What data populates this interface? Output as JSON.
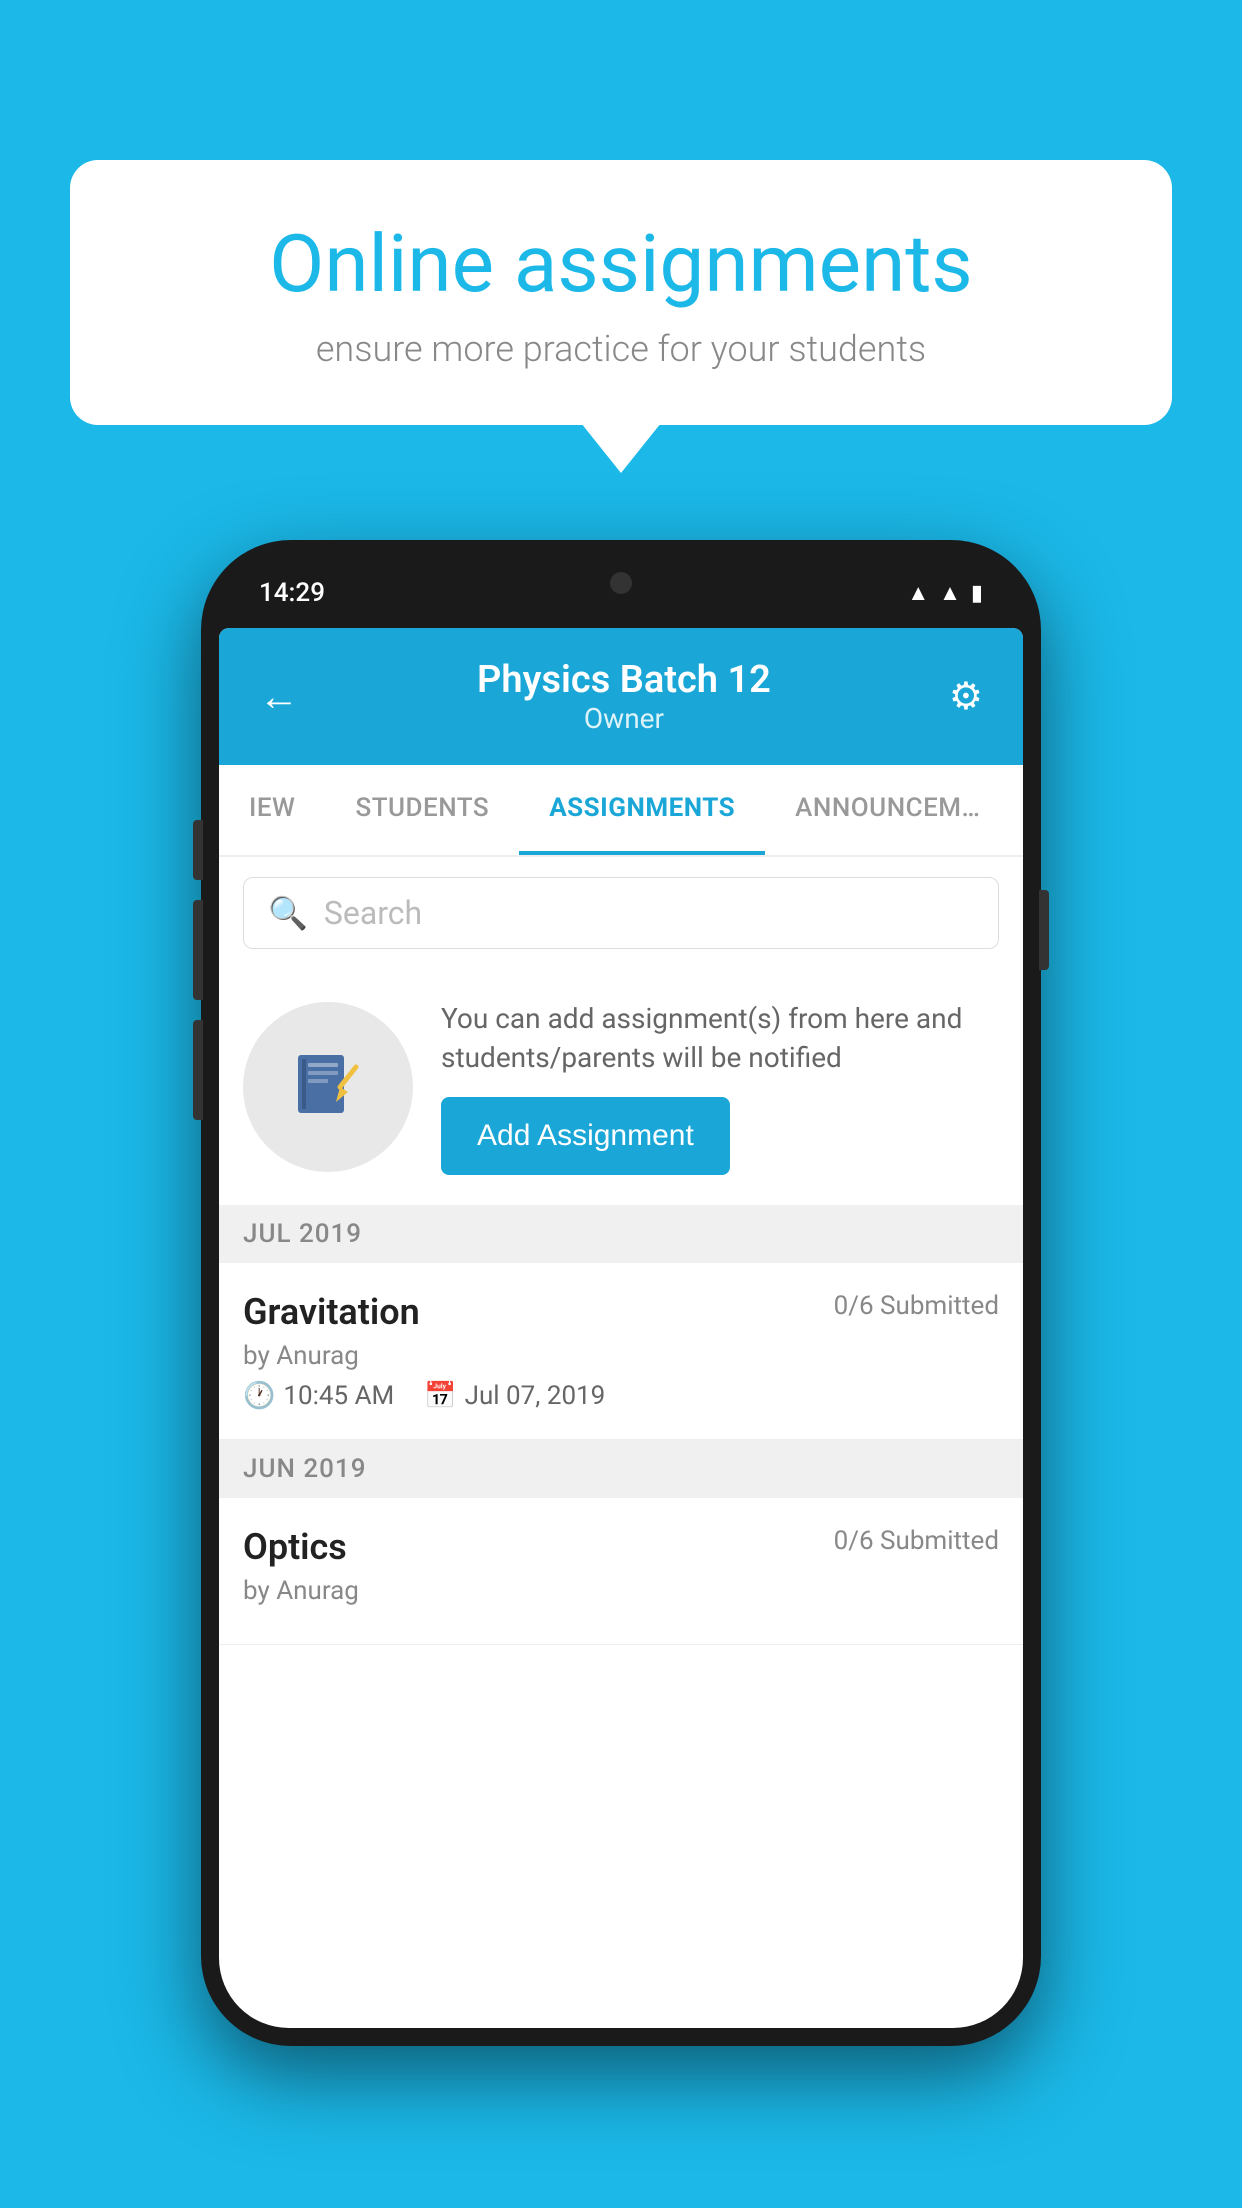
{
  "background_color": "#1BB8E8",
  "speech_bubble": {
    "title": "Online assignments",
    "subtitle": "ensure more practice for your students"
  },
  "phone": {
    "status_bar": {
      "time": "14:29",
      "icons": [
        "wifi",
        "signal",
        "battery"
      ]
    },
    "header": {
      "title": "Physics Batch 12",
      "subtitle": "Owner",
      "back_label": "←",
      "settings_label": "⚙"
    },
    "tabs": [
      {
        "label": "IEW",
        "active": false
      },
      {
        "label": "STUDENTS",
        "active": false
      },
      {
        "label": "ASSIGNMENTS",
        "active": true
      },
      {
        "label": "ANNOUNCEM…",
        "active": false
      }
    ],
    "search": {
      "placeholder": "Search"
    },
    "add_section": {
      "description": "You can add assignment(s) from here and students/parents will be notified",
      "button_label": "Add Assignment"
    },
    "sections": [
      {
        "month": "JUL 2019",
        "assignments": [
          {
            "name": "Gravitation",
            "submitted": "0/6 Submitted",
            "by": "by Anurag",
            "time": "10:45 AM",
            "date": "Jul 07, 2019"
          }
        ]
      },
      {
        "month": "JUN 2019",
        "assignments": [
          {
            "name": "Optics",
            "submitted": "0/6 Submitted",
            "by": "by Anurag",
            "time": "",
            "date": ""
          }
        ]
      }
    ]
  }
}
